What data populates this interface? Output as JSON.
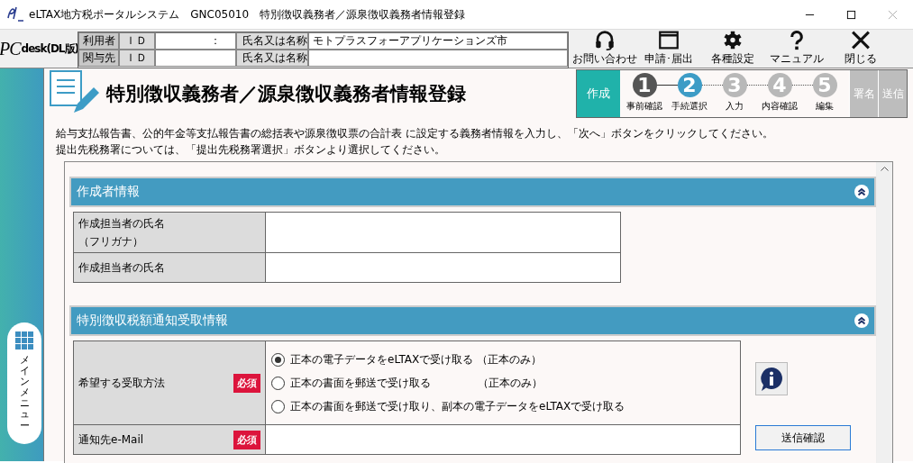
{
  "window": {
    "title": "eLTAX地方税ポータルシステム　GNC05010　特別徴収義務者／源泉徴収義務者情報登録"
  },
  "header": {
    "logo_main": "PC",
    "logo_sub": "desk",
    "logo_edition": "(DL版)",
    "info_rows": [
      {
        "label": "利用者",
        "id_label": "ＩＤ",
        "id_value": "：",
        "name_label": "氏名又は名称",
        "name_value": "モトプラスフォーアプリケーションズ市"
      },
      {
        "label": "関与先",
        "id_label": "ＩＤ",
        "name_label": "氏名又は名称"
      }
    ],
    "toolbar": [
      {
        "kind": "headset",
        "label": "お問い合わせ"
      },
      {
        "kind": "window",
        "label": "申請･届出"
      },
      {
        "kind": "gear",
        "label": "各種設定"
      },
      {
        "kind": "help",
        "label": "マニュアル"
      },
      {
        "kind": "close",
        "label": "閉じる"
      }
    ]
  },
  "page": {
    "title": "特別徴収義務者／源泉徴収義務者情報登録",
    "steps": {
      "start": "作成",
      "items": [
        {
          "number": "1",
          "label": "事前確認",
          "completed": true,
          "selected": false
        },
        {
          "number": "2",
          "label": "手続選択",
          "completed": false,
          "selected": true
        },
        {
          "number": "3",
          "label": "入力",
          "completed": false,
          "selected": false
        },
        {
          "number": "4",
          "label": "内容確認",
          "completed": false,
          "selected": false
        },
        {
          "number": "5",
          "label": "編集",
          "completed": false,
          "selected": false
        }
      ],
      "end": [
        "署名",
        "送信"
      ]
    },
    "description": [
      "給与支払報告書、公的年金等支払報告書の総括表や源泉徴収票の合計表 に設定する義務者情報を入力し、「次へ」ボタンをクリックしてください。",
      "提出先税務署については、「提出先税務署選択」ボタンより選択してください。"
    ]
  },
  "sidebar": {
    "main_menu": "メインメニュー"
  },
  "sections": [
    {
      "title": "作成者情報",
      "expanded": true,
      "rows": [
        {
          "kind": "text",
          "label": "作成担当者の氏名",
          "label_sub": "（フリガナ）"
        },
        {
          "kind": "text",
          "label": "作成担当者の氏名"
        }
      ]
    },
    {
      "title": "特別徴収税額通知受取情報",
      "expanded": true,
      "rows": [
        {
          "kind": "radio",
          "label": "希望する受取方法",
          "required": "必須",
          "options": [
            {
              "label": "正本の電子データをeLTAXで受け取る （正本のみ）",
              "selected": true
            },
            {
              "label": "正本の書面を郵送で受け取る　　　　 （正本のみ）",
              "selected": false
            },
            {
              "label": "正本の書面を郵送で受け取り、副本の電子データをeLTAXで受け取る",
              "selected": false
            }
          ]
        },
        {
          "kind": "text",
          "label": "通知先e-Mail",
          "required": "必須"
        }
      ],
      "side_button": "送信確認"
    }
  ]
}
